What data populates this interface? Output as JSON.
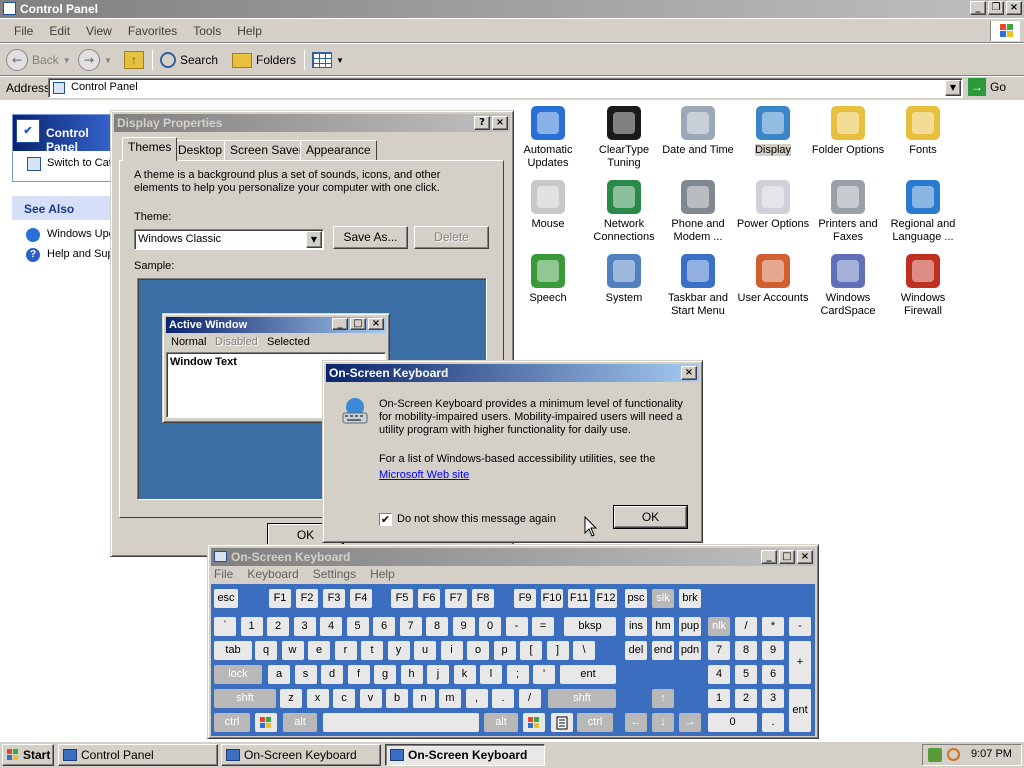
{
  "control_panel": {
    "title": "Control Panel",
    "menu": [
      "File",
      "Edit",
      "View",
      "Favorites",
      "Tools",
      "Help"
    ],
    "toolbar": {
      "back": "Back",
      "search": "Search",
      "folders": "Folders"
    },
    "address_label": "Address",
    "address_value": "Control Panel",
    "go": "Go",
    "sidebar": {
      "pane_title": "Control Panel",
      "switch_link": "Switch to Category View",
      "see_also_title": "See Also",
      "see_also": [
        "Windows Update",
        "Help and Support"
      ]
    },
    "items": [
      {
        "label": "Automatic Updates",
        "color": "#2a6fd6"
      },
      {
        "label": "ClearType Tuning",
        "color": "#1a1a1a"
      },
      {
        "label": "Date and Time",
        "color": "#9aa8b8"
      },
      {
        "label": "Display",
        "color": "#3a86c8",
        "selected": true
      },
      {
        "label": "Folder Options",
        "color": "#e8c040"
      },
      {
        "label": "Fonts",
        "color": "#e8c040"
      },
      {
        "label": "Mouse",
        "color": "#c8c8c8"
      },
      {
        "label": "Network Connections",
        "color": "#2a8a4a"
      },
      {
        "label": "Phone and Modem ...",
        "color": "#808890"
      },
      {
        "label": "Power Options",
        "color": "#d0d0d8"
      },
      {
        "label": "Printers and Faxes",
        "color": "#9aa0a8"
      },
      {
        "label": "Regional and Language ...",
        "color": "#2a7ad0"
      },
      {
        "label": "Speech",
        "color": "#3a9a3a"
      },
      {
        "label": "System",
        "color": "#5080c0"
      },
      {
        "label": "Taskbar and Start Menu",
        "color": "#3a70c8"
      },
      {
        "label": "User Accounts",
        "color": "#d06030"
      },
      {
        "label": "Windows CardSpace",
        "color": "#6070b8"
      },
      {
        "label": "Windows Firewall",
        "color": "#c03020"
      }
    ]
  },
  "display_properties": {
    "title": "Display Properties",
    "tabs": [
      "Themes",
      "Desktop",
      "Screen Saver",
      "Appearance"
    ],
    "description": "A theme is a background plus a set of sounds, icons, and other elements to help you personalize your computer with one click.",
    "theme_label": "Theme:",
    "theme_value": "Windows Classic",
    "save_as": "Save As...",
    "delete": "Delete",
    "sample_label": "Sample:",
    "sample": {
      "window_title": "Active Window",
      "menu": [
        "Normal",
        "Disabled",
        "Selected"
      ],
      "window_text": "Window Text"
    },
    "ok": "OK"
  },
  "osk_dialog": {
    "title": "On-Screen Keyboard",
    "message": "On-Screen Keyboard provides a minimum level of functionality for mobility-impaired users. Mobility-impaired users will need a utility program with higher functionality for daily use.",
    "message2": "For a list of Windows-based accessibility utilities, see the",
    "link": "Microsoft Web site",
    "checkbox": "Do not show this message again",
    "checkbox_checked": true,
    "ok": "OK"
  },
  "osk": {
    "title": "On-Screen Keyboard",
    "menu": [
      "File",
      "Keyboard",
      "Settings",
      "Help"
    ],
    "row_fn": [
      "esc",
      "F1",
      "F2",
      "F3",
      "F4",
      "F5",
      "F6",
      "F7",
      "F8",
      "F9",
      "F10",
      "F11",
      "F12",
      "psc",
      "slk",
      "brk"
    ],
    "row_num": [
      "`",
      "1",
      "2",
      "3",
      "4",
      "5",
      "6",
      "7",
      "8",
      "9",
      "0",
      "-",
      "=",
      "bksp",
      "ins",
      "hm",
      "pup",
      "nlk",
      "/",
      "*",
      "-"
    ],
    "row_tab": [
      "tab",
      "q",
      "w",
      "e",
      "r",
      "t",
      "y",
      "u",
      "i",
      "o",
      "p",
      "[",
      "]",
      "\\",
      "del",
      "end",
      "pdn",
      "7",
      "8",
      "9",
      "+"
    ],
    "row_caps": [
      "lock",
      "a",
      "s",
      "d",
      "f",
      "g",
      "h",
      "j",
      "k",
      "l",
      ";",
      "'",
      "ent",
      "4",
      "5",
      "6"
    ],
    "row_shift": [
      "shft",
      "z",
      "x",
      "c",
      "v",
      "b",
      "n",
      "m",
      ",",
      ".",
      "/",
      "shft",
      "↑",
      "1",
      "2",
      "3",
      "ent"
    ],
    "row_ctrl": [
      "ctrl",
      "alt",
      "alt",
      "ctrl",
      "←",
      "↓",
      "→",
      "0",
      "."
    ]
  },
  "taskbar": {
    "start": "Start",
    "tasks": [
      "Control Panel",
      "On-Screen Keyboard",
      "On-Screen Keyboard"
    ],
    "clock": "9:07 PM"
  }
}
